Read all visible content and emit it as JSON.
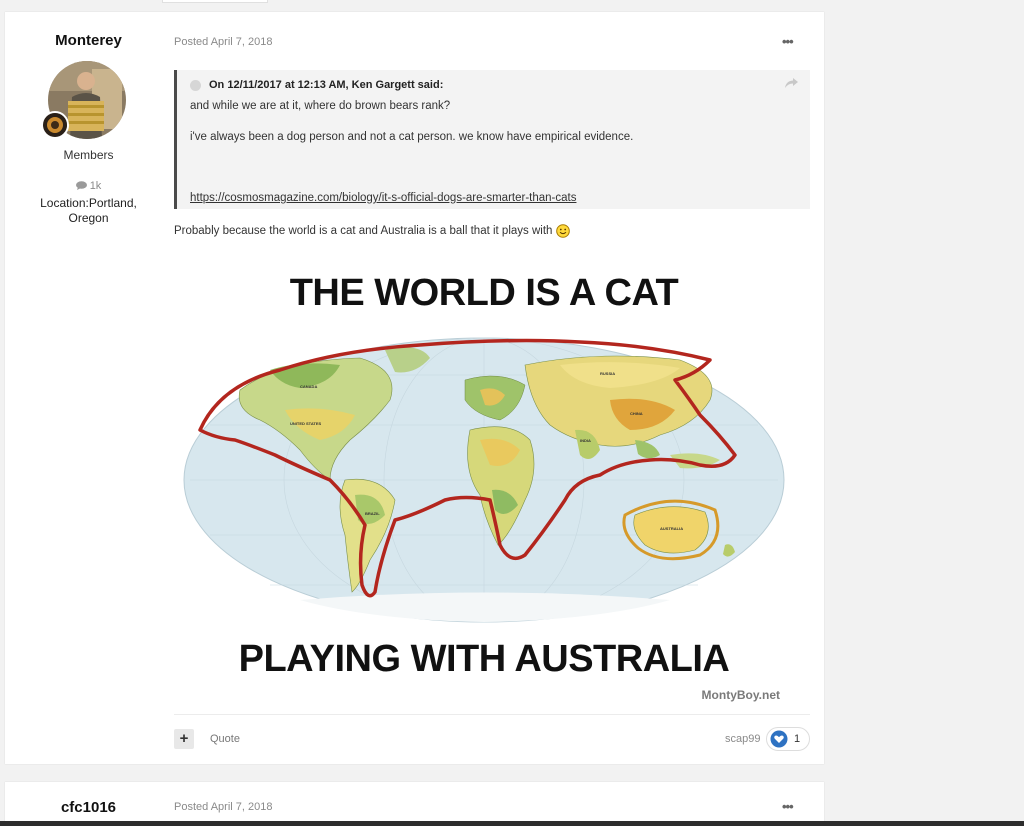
{
  "post1": {
    "author": "Monterey",
    "group": "Members",
    "content_count": "1k",
    "location": "Location:Portland, Oregon",
    "posted": "Posted April 7, 2018",
    "quote": {
      "header": "On 12/11/2017 at 12:13 AM, Ken Gargett said:",
      "line1": "and while we are at it, where do brown bears rank?",
      "line2": "i've always been a dog person and not a cat person. we know have empirical evidence.",
      "link": "https://cosmosmagazine.com/biology/it-s-official-dogs-are-smarter-than-cats"
    },
    "body": "Probably because the world is a cat and Australia is a ball that it plays with",
    "meme": {
      "top_text": "THE WORLD IS A CAT",
      "bottom_text": "PLAYING WITH AUSTRALIA",
      "credit": "MontyBoy.net",
      "map_labels": {
        "canada": "CANADA",
        "united_states": "UNITED STATES",
        "brazil": "BRAZIL",
        "russia": "RUSSIA",
        "china": "CHINA",
        "india": "INDIA",
        "australia": "AUSTRALIA"
      }
    },
    "footer": {
      "plus": "+",
      "quote_label": "Quote",
      "reacted_by": "scap99",
      "reaction_count": "1"
    }
  },
  "post2": {
    "author": "cfc1016",
    "posted": "Posted April 7, 2018"
  },
  "colors": {
    "link": "#333333",
    "reaction": "#2e72c2",
    "cat_outline": "#b3261e",
    "ocean": "#d7e7ee"
  }
}
